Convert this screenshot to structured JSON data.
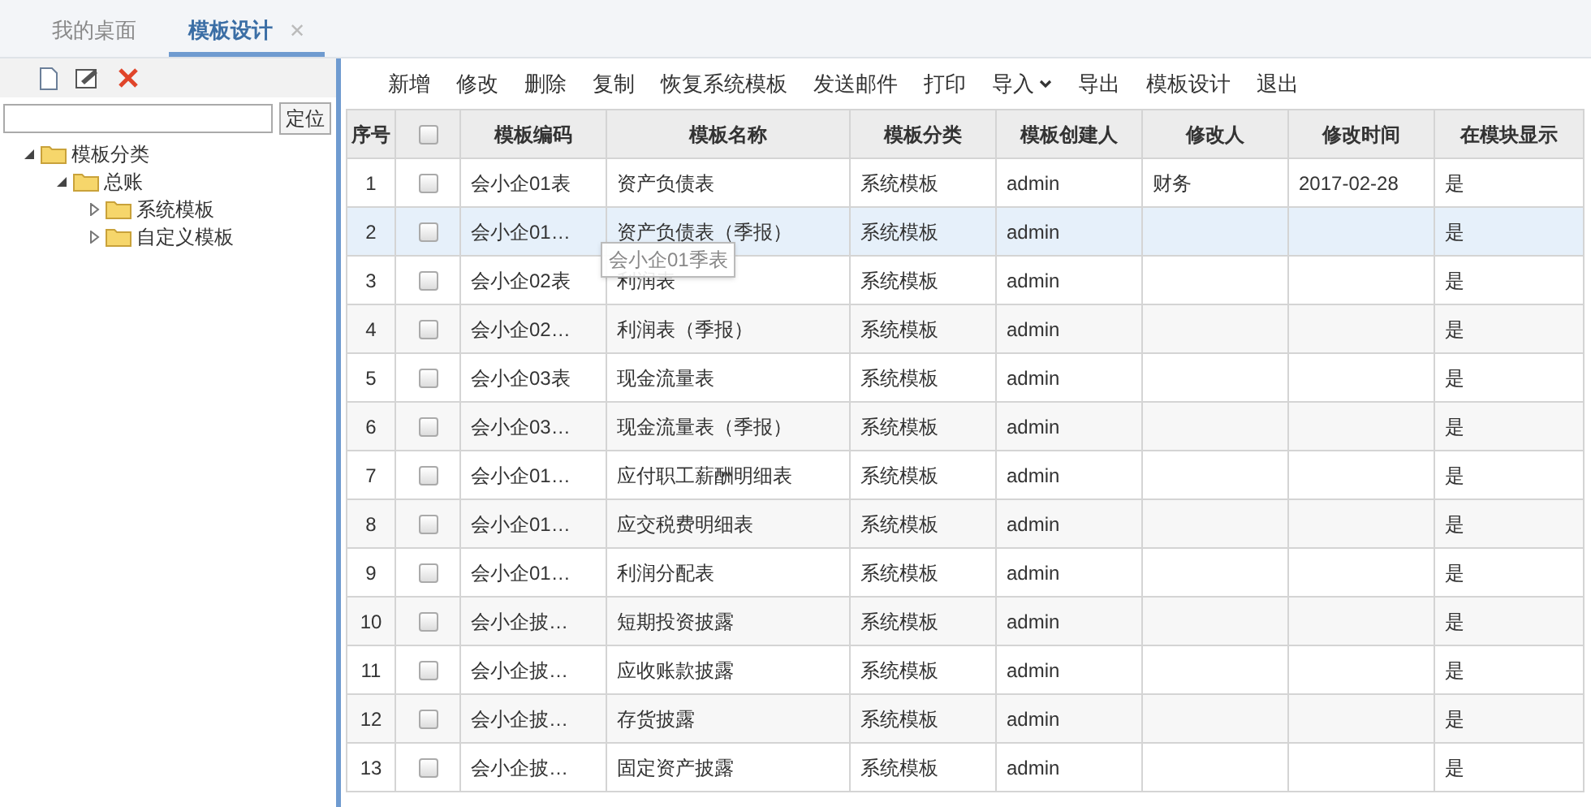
{
  "tabs": [
    {
      "label": "我的桌面",
      "selected": false,
      "closable": false
    },
    {
      "label": "模板设计",
      "selected": true,
      "closable": true,
      "close": "✕"
    }
  ],
  "sidebar": {
    "locate_button": "定位",
    "tree": [
      {
        "label": "模板分类",
        "expanded": true,
        "children": [
          {
            "label": "总账",
            "expanded": true,
            "children": [
              {
                "label": "系统模板",
                "expanded": false
              },
              {
                "label": "自定义模板",
                "expanded": false
              }
            ]
          }
        ]
      }
    ]
  },
  "toolbar": [
    {
      "label": "新增"
    },
    {
      "label": "修改"
    },
    {
      "label": "删除"
    },
    {
      "label": "复制"
    },
    {
      "label": "恢复系统模板"
    },
    {
      "label": "发送邮件"
    },
    {
      "label": "打印"
    },
    {
      "label": "导入",
      "dropdown": true
    },
    {
      "label": "导出"
    },
    {
      "label": "模板设计"
    },
    {
      "label": "退出"
    }
  ],
  "table": {
    "columns": [
      "序号",
      "",
      "模板编码",
      "模板名称",
      "模板分类",
      "模板创建人",
      "修改人",
      "修改时间",
      "在模块显示"
    ],
    "select_all_checked": false,
    "rows": [
      {
        "cells": [
          "1",
          "",
          "会小企01表",
          "资产负债表",
          "系统模板",
          "admin",
          "财务",
          "2017-02-28",
          "是"
        ],
        "checked": false,
        "selected": false
      },
      {
        "cells": [
          "2",
          "",
          "会小企01…",
          "资产负债表（季报）",
          "系统模板",
          "admin",
          "",
          "",
          "是"
        ],
        "checked": false,
        "selected": true
      },
      {
        "cells": [
          "3",
          "",
          "会小企02表",
          "利润表",
          "系统模板",
          "admin",
          "",
          "",
          "是"
        ],
        "checked": false,
        "selected": false
      },
      {
        "cells": [
          "4",
          "",
          "会小企02…",
          "利润表（季报）",
          "系统模板",
          "admin",
          "",
          "",
          "是"
        ],
        "checked": false,
        "selected": false
      },
      {
        "cells": [
          "5",
          "",
          "会小企03表",
          "现金流量表",
          "系统模板",
          "admin",
          "",
          "",
          "是"
        ],
        "checked": false,
        "selected": false
      },
      {
        "cells": [
          "6",
          "",
          "会小企03…",
          "现金流量表（季报）",
          "系统模板",
          "admin",
          "",
          "",
          "是"
        ],
        "checked": false,
        "selected": false
      },
      {
        "cells": [
          "7",
          "",
          "会小企01…",
          "应付职工薪酬明细表",
          "系统模板",
          "admin",
          "",
          "",
          "是"
        ],
        "checked": false,
        "selected": false
      },
      {
        "cells": [
          "8",
          "",
          "会小企01…",
          "应交税费明细表",
          "系统模板",
          "admin",
          "",
          "",
          "是"
        ],
        "checked": false,
        "selected": false
      },
      {
        "cells": [
          "9",
          "",
          "会小企01…",
          "利润分配表",
          "系统模板",
          "admin",
          "",
          "",
          "是"
        ],
        "checked": false,
        "selected": false
      },
      {
        "cells": [
          "10",
          "",
          "会小企披…",
          "短期投资披露",
          "系统模板",
          "admin",
          "",
          "",
          "是"
        ],
        "checked": false,
        "selected": false
      },
      {
        "cells": [
          "11",
          "",
          "会小企披…",
          "应收账款披露",
          "系统模板",
          "admin",
          "",
          "",
          "是"
        ],
        "checked": false,
        "selected": false
      },
      {
        "cells": [
          "12",
          "",
          "会小企披…",
          "存货披露",
          "系统模板",
          "admin",
          "",
          "",
          "是"
        ],
        "checked": false,
        "selected": false
      },
      {
        "cells": [
          "13",
          "",
          "会小企披…",
          "固定资产披露",
          "系统模板",
          "admin",
          "",
          "",
          "是"
        ],
        "checked": false,
        "selected": false
      }
    ]
  },
  "tooltip": "会小企01季表"
}
